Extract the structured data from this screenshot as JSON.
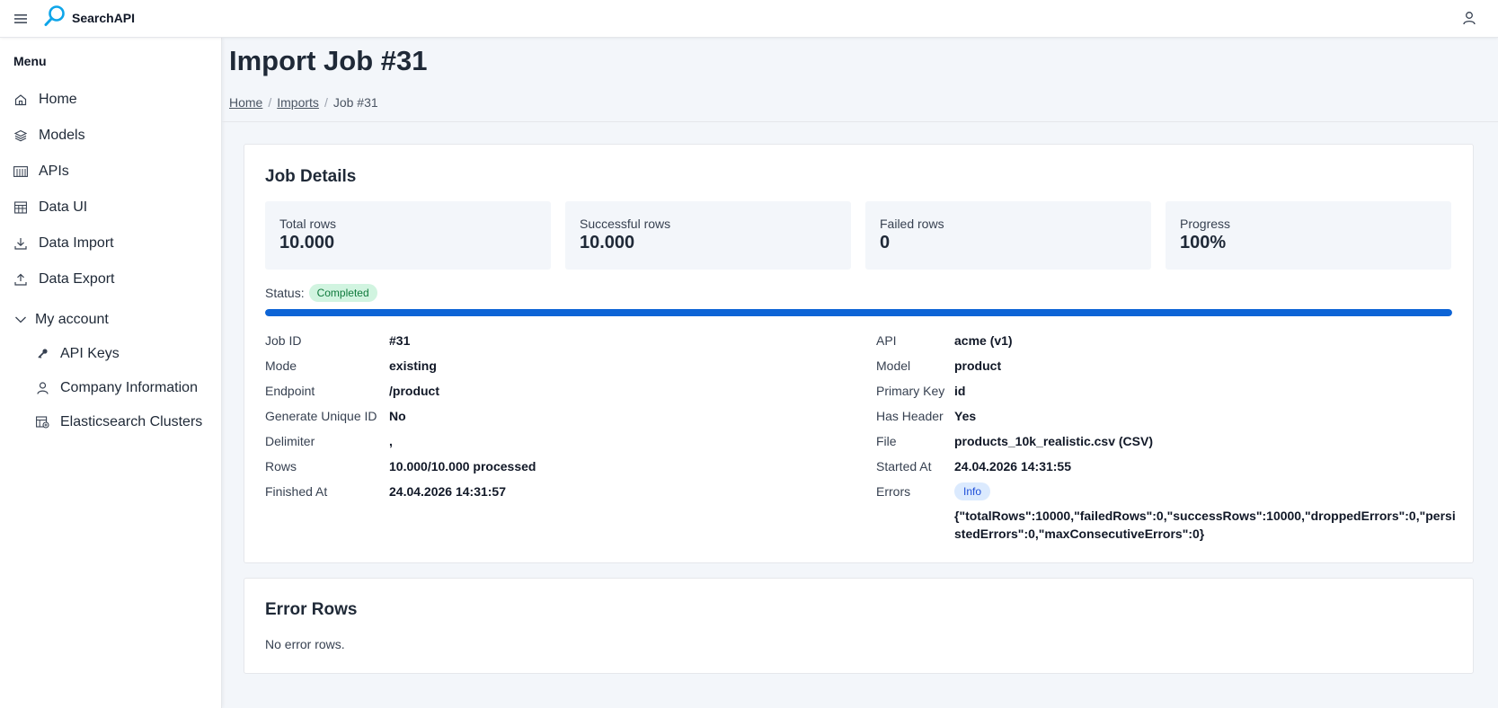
{
  "app": {
    "name": "SearchAPI",
    "brand_color": "#0d64d6"
  },
  "sidebar": {
    "title": "Menu",
    "items": [
      {
        "label": "Home",
        "icon": "home-icon"
      },
      {
        "label": "Models",
        "icon": "layers-icon"
      },
      {
        "label": "APIs",
        "icon": "api-icon"
      },
      {
        "label": "Data UI",
        "icon": "table-icon"
      },
      {
        "label": "Data Import",
        "icon": "download-icon"
      },
      {
        "label": "Data Export",
        "icon": "upload-icon"
      }
    ],
    "account": {
      "label": "My account",
      "items": [
        {
          "label": "API Keys",
          "icon": "key-icon"
        },
        {
          "label": "Company Information",
          "icon": "user-icon"
        },
        {
          "label": "Elasticsearch Clusters",
          "icon": "cluster-icon"
        }
      ]
    }
  },
  "page": {
    "title": "Import Job #31",
    "breadcrumb": [
      "Home",
      "Imports",
      "Job #31"
    ]
  },
  "job_details": {
    "title": "Job Details",
    "stats": [
      {
        "label": "Total rows",
        "value": "10.000"
      },
      {
        "label": "Successful rows",
        "value": "10.000"
      },
      {
        "label": "Failed rows",
        "value": "0"
      },
      {
        "label": "Progress",
        "value": "100%"
      }
    ],
    "status_label": "Status:",
    "status": "Completed",
    "progress_fraction": 1.0,
    "left": [
      {
        "key": "Job ID",
        "value": "#31"
      },
      {
        "key": "Mode",
        "value": "existing"
      },
      {
        "key": "Endpoint",
        "value": "/product"
      },
      {
        "key": "Generate Unique ID",
        "value": "No"
      },
      {
        "key": "Delimiter",
        "value": ","
      },
      {
        "key": "Rows",
        "value": "10.000/10.000 processed"
      },
      {
        "key": "Finished At",
        "value": "24.04.2026 14:31:57"
      }
    ],
    "right": [
      {
        "key": "API",
        "value": "acme (v1)"
      },
      {
        "key": "Model",
        "value": "product"
      },
      {
        "key": "Primary Key",
        "value": "id"
      },
      {
        "key": "Has Header",
        "value": "Yes"
      },
      {
        "key": "File",
        "value": "products_10k_realistic.csv (CSV)"
      },
      {
        "key": "Started At",
        "value": "24.04.2026 14:31:55"
      },
      {
        "key": "Errors",
        "value": "Info"
      }
    ],
    "errors_json": "{\"totalRows\":10000,\"failedRows\":0,\"successRows\":10000,\"droppedErrors\":0,\"persistedErrors\":0,\"maxConsecutiveErrors\":0}"
  },
  "error_rows": {
    "title": "Error Rows",
    "empty_text": "No error rows."
  }
}
